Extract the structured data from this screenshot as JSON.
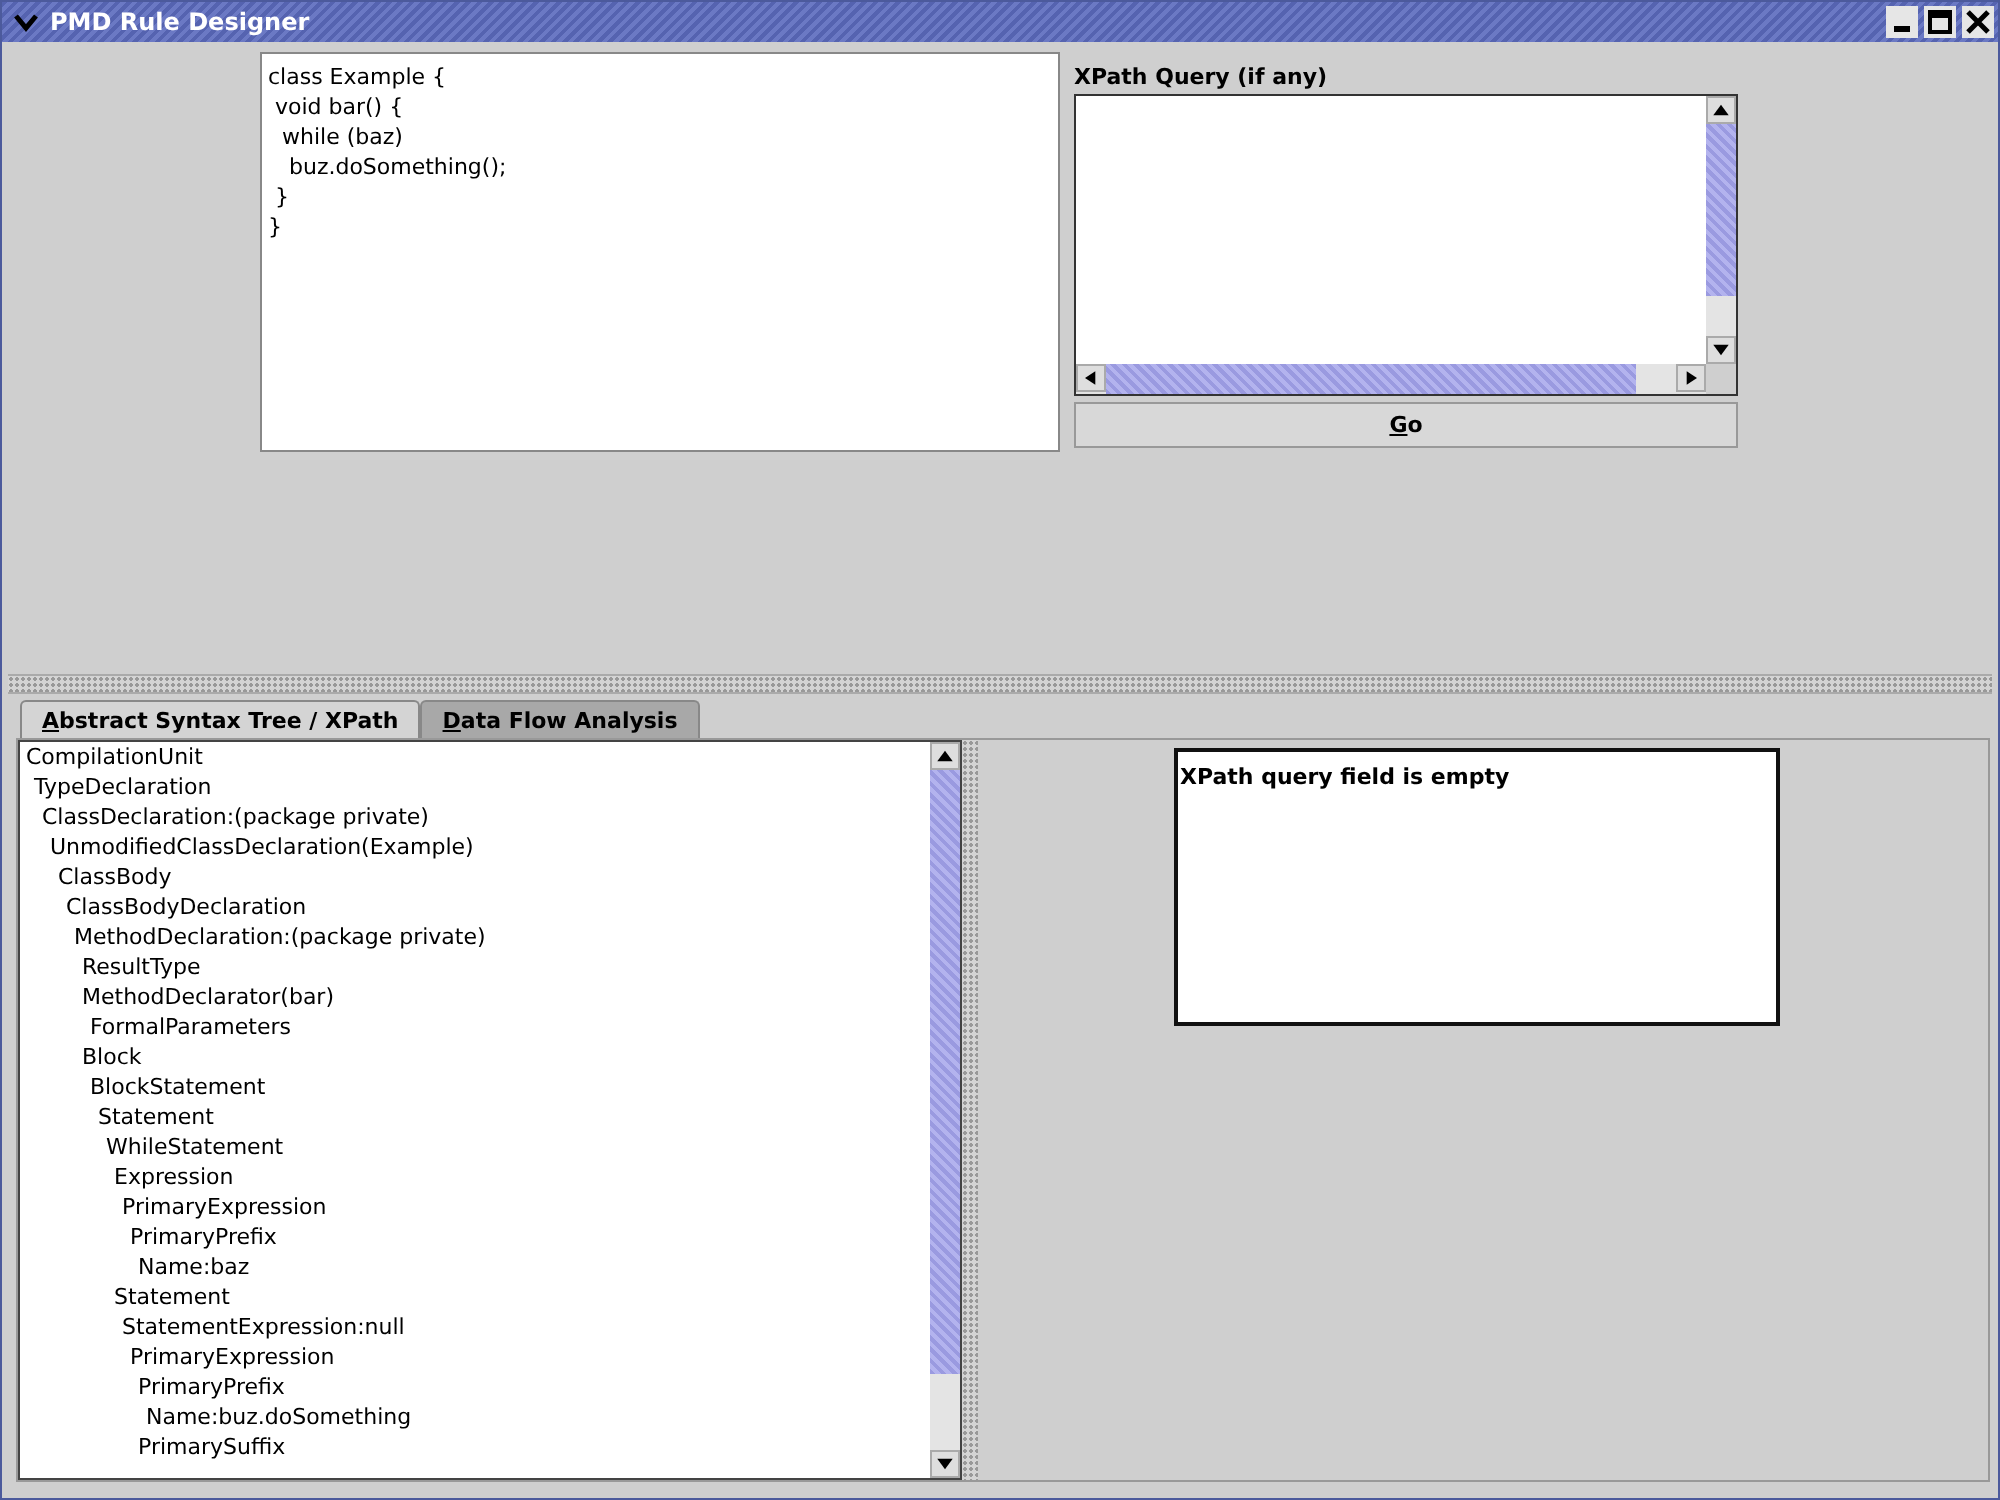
{
  "window": {
    "title": "PMD Rule Designer"
  },
  "source_editor": {
    "value": "class Example {\n void bar() {\n  while (baz)\n   buz.doSomething();\n }\n}"
  },
  "xpath": {
    "label": "XPath Query (if any)",
    "go_button": "Go"
  },
  "tabs": [
    {
      "label": "Abstract Syntax Tree / XPath",
      "selected": true
    },
    {
      "label": "Data Flow Analysis",
      "selected": false
    }
  ],
  "ast_tree": [
    {
      "label": "CompilationUnit",
      "children": [
        {
          "label": "TypeDeclaration",
          "children": [
            {
              "label": "ClassDeclaration:(package private)",
              "children": [
                {
                  "label": "UnmodifiedClassDeclaration(Example)",
                  "children": [
                    {
                      "label": "ClassBody",
                      "children": [
                        {
                          "label": "ClassBodyDeclaration",
                          "children": [
                            {
                              "label": "MethodDeclaration:(package private)",
                              "children": [
                                {
                                  "label": "ResultType"
                                },
                                {
                                  "label": "MethodDeclarator(bar)",
                                  "children": [
                                    {
                                      "label": "FormalParameters"
                                    }
                                  ]
                                },
                                {
                                  "label": "Block",
                                  "children": [
                                    {
                                      "label": "BlockStatement",
                                      "children": [
                                        {
                                          "label": "Statement",
                                          "children": [
                                            {
                                              "label": "WhileStatement",
                                              "children": [
                                                {
                                                  "label": "Expression",
                                                  "children": [
                                                    {
                                                      "label": "PrimaryExpression",
                                                      "children": [
                                                        {
                                                          "label": "PrimaryPrefix",
                                                          "children": [
                                                            {
                                                              "label": "Name:baz"
                                                            }
                                                          ]
                                                        }
                                                      ]
                                                    }
                                                  ]
                                                },
                                                {
                                                  "label": "Statement",
                                                  "children": [
                                                    {
                                                      "label": "StatementExpression:null",
                                                      "children": [
                                                        {
                                                          "label": "PrimaryExpression",
                                                          "children": [
                                                            {
                                                              "label": "PrimaryPrefix",
                                                              "children": [
                                                                {
                                                                  "label": "Name:buz.doSomething"
                                                                }
                                                              ]
                                                            },
                                                            {
                                                              "label": "PrimarySuffix"
                                                            }
                                                          ]
                                                        }
                                                      ]
                                                    }
                                                  ]
                                                }
                                              ]
                                            }
                                          ]
                                        }
                                      ]
                                    }
                                  ]
                                }
                              ]
                            }
                          ]
                        }
                      ]
                    }
                  ]
                }
              ]
            }
          ]
        }
      ]
    }
  ],
  "xpath_result": {
    "message": "XPath query field is empty"
  }
}
